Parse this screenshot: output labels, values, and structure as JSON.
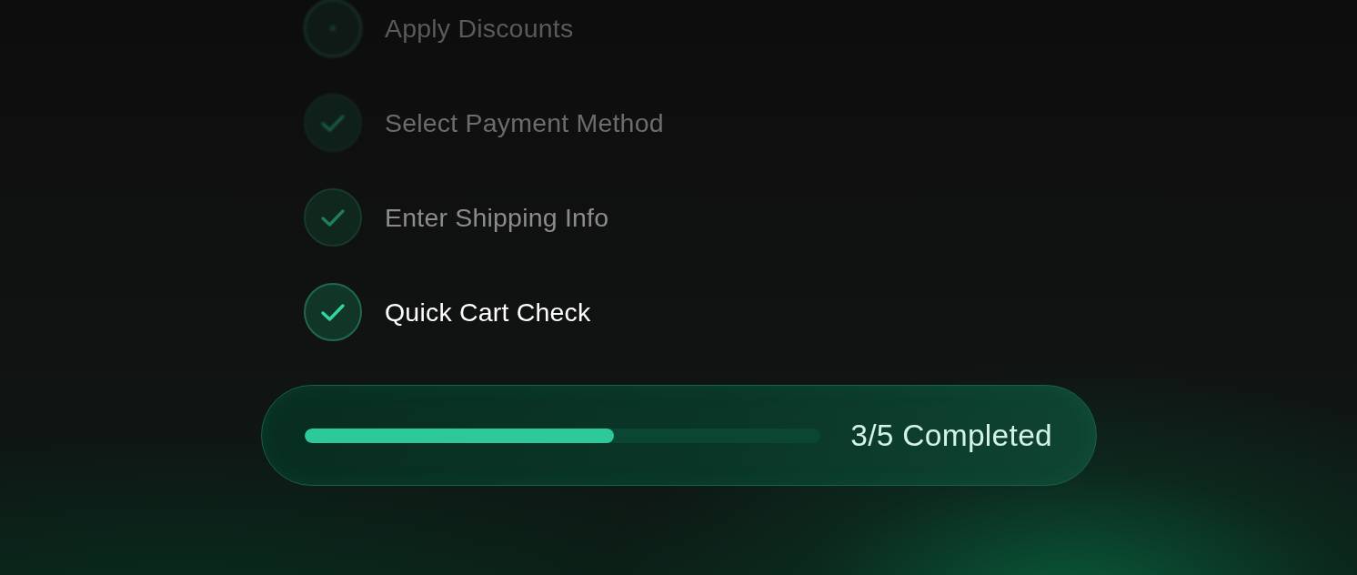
{
  "steps": [
    {
      "label": "Apply Discounts",
      "checked": false,
      "active": false
    },
    {
      "label": "Select Payment Method",
      "checked": true,
      "active": false
    },
    {
      "label": "Enter Shipping Info",
      "checked": true,
      "active": false
    },
    {
      "label": "Quick Cart Check",
      "checked": true,
      "active": true
    }
  ],
  "progress": {
    "level": 0.6,
    "label": "3/5 Completed"
  }
}
